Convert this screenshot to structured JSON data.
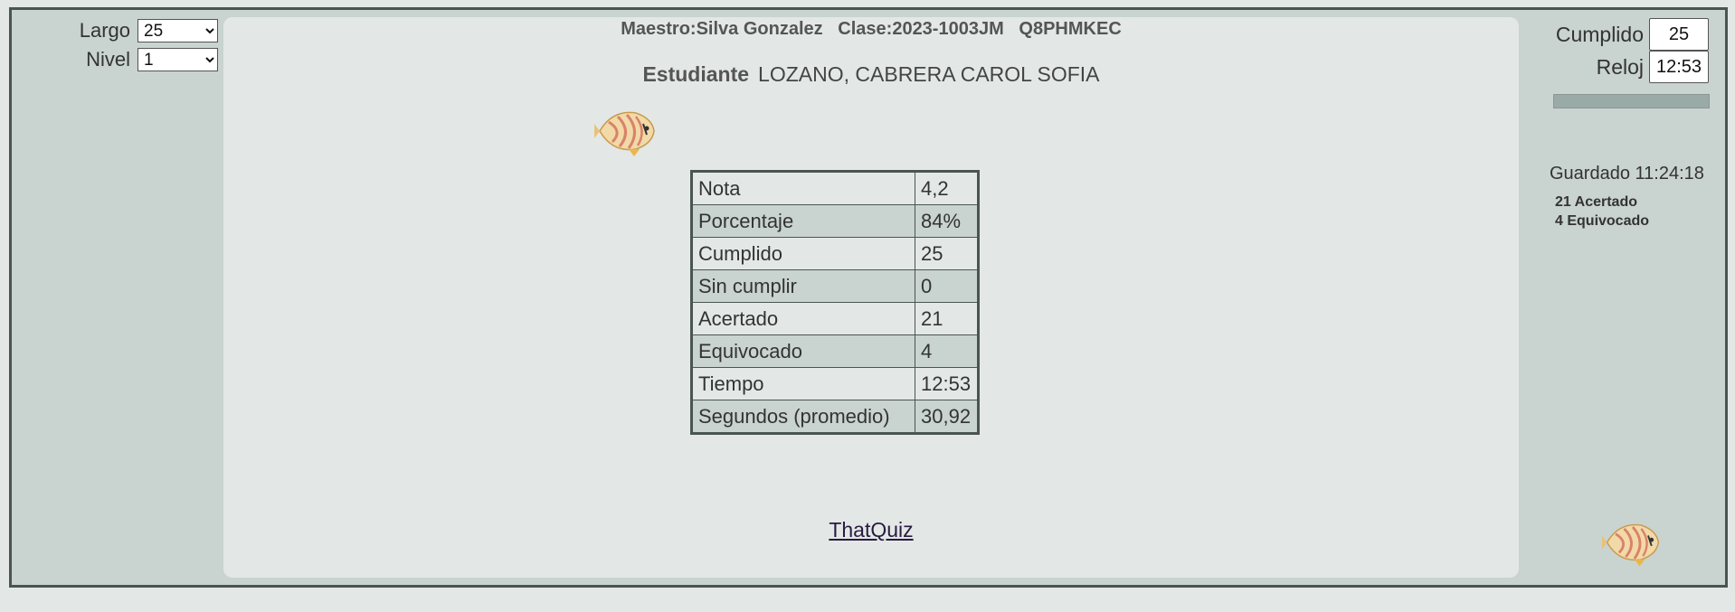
{
  "left": {
    "largo_label": "Largo",
    "largo_value": "25",
    "nivel_label": "Nivel",
    "nivel_value": "1"
  },
  "header": {
    "line": "Maestro:Silva Gonzalez   Clase:2023-1003JM   Q8PHMKEC",
    "student_label": "Estudiante",
    "student_name": "LOZANO, CABRERA CAROL SOFIA"
  },
  "results": [
    {
      "label": "Nota",
      "value": "4,2"
    },
    {
      "label": "Porcentaje",
      "value": "84%"
    },
    {
      "label": "Cumplido",
      "value": "25"
    },
    {
      "label": "Sin cumplir",
      "value": "0"
    },
    {
      "label": "Acertado",
      "value": "21"
    },
    {
      "label": "Equivocado",
      "value": "4"
    },
    {
      "label": "Tiempo",
      "value": "12:53"
    },
    {
      "label": "Segundos (promedio)",
      "value": "30,92"
    }
  ],
  "footer": {
    "link": "ThatQuiz"
  },
  "right": {
    "cumplido_label": "Cumplido",
    "cumplido_value": "25",
    "reloj_label": "Reloj",
    "reloj_value": "12:53",
    "progress": 1.0,
    "saved": "Guardado 11:24:18",
    "correct": "21 Acertado",
    "wrong": "4 Equivocado"
  },
  "colors": {
    "frame": "#4a5552",
    "panel": "#c9d3d0",
    "main": "#e3e8e6",
    "fish_body": "#f2d9a8",
    "fish_stripe": "#d9826a"
  },
  "icons": [
    "butterflyfish-icon"
  ]
}
